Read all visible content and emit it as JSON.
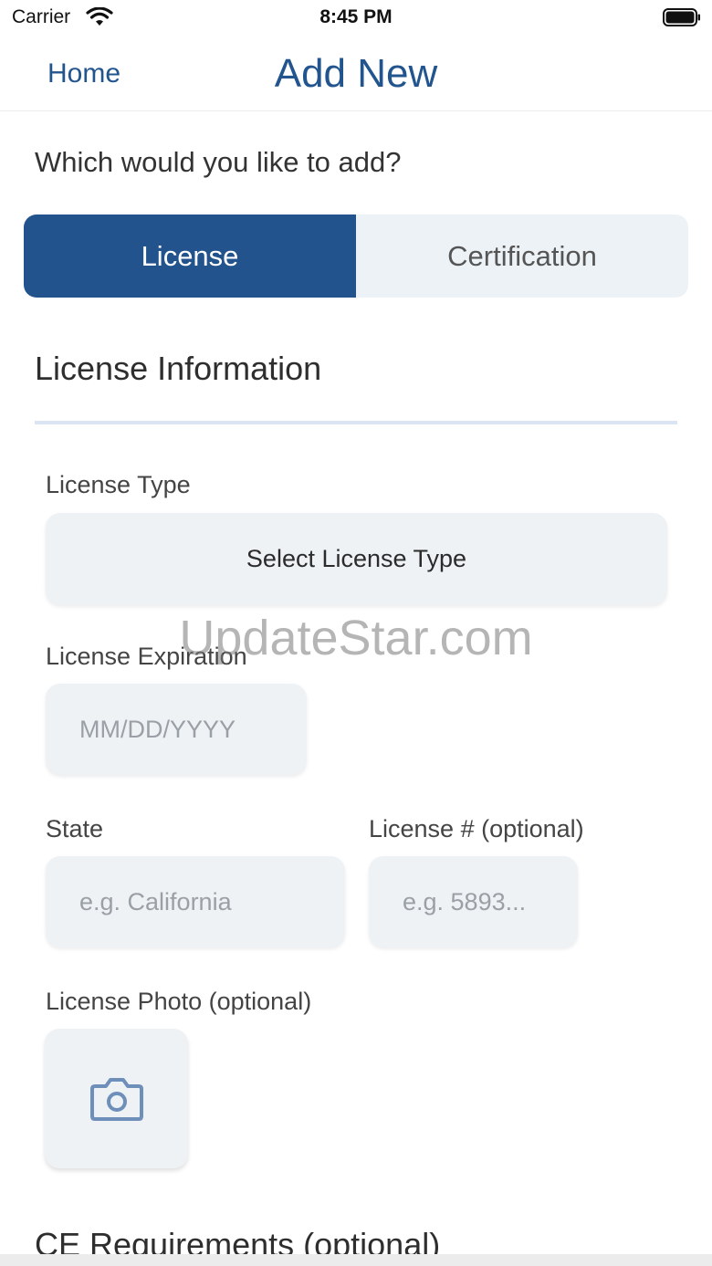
{
  "status_bar": {
    "carrier": "Carrier",
    "time": "8:45 PM"
  },
  "nav": {
    "back_label": "Home",
    "title": "Add New"
  },
  "prompt": "Which would you like to add?",
  "segments": [
    {
      "label": "License",
      "selected": true
    },
    {
      "label": "Certification",
      "selected": false
    }
  ],
  "section_title": "License Information",
  "fields": {
    "license_type": {
      "label": "License Type",
      "value": "Select License Type"
    },
    "expiration": {
      "label": "License Expiration",
      "placeholder": "MM/DD/YYYY"
    },
    "state": {
      "label": "State",
      "placeholder": "e.g. California"
    },
    "license_number": {
      "label": "License # (optional)",
      "placeholder": "e.g. 5893..."
    },
    "photo": {
      "label": "License Photo (optional)",
      "icon": "camera-icon"
    }
  },
  "ce_title": "CE Requirements (optional)",
  "watermark": "UpdateStar.com",
  "colors": {
    "accent": "#22538c",
    "field_bg": "#eef2f5",
    "icon": "#6d8fb9"
  }
}
